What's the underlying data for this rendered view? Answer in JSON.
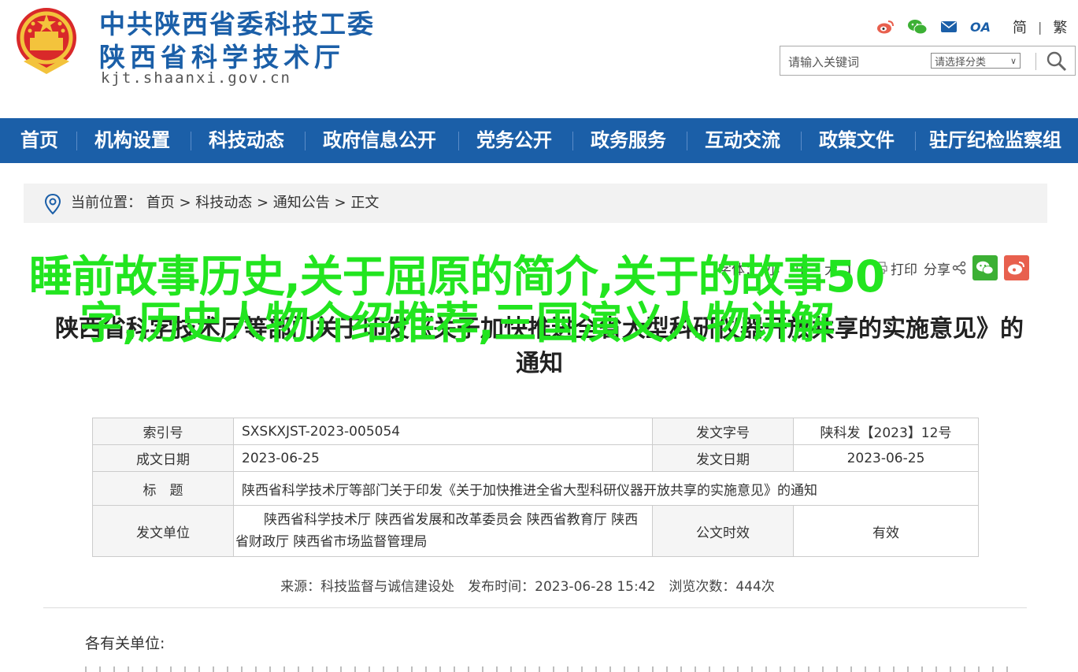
{
  "header": {
    "org_line1": "中共陕西省委科技工委",
    "org_line2": "陕西省科学技术厅",
    "domain": "kjt.shaanxi.gov.cn",
    "icons": [
      "weibo-icon",
      "wechat-icon",
      "mail-icon",
      "oa-icon"
    ],
    "oa_label": "OA",
    "lang_simplified": "简",
    "lang_sep": "|",
    "lang_traditional": "繁",
    "search": {
      "placeholder": "请输入关键词",
      "category_select": "请选择分类",
      "category_caret": "∨"
    }
  },
  "nav": {
    "items": [
      "首页",
      "机构设置",
      "科技动态",
      "政府信息公开",
      "党务公开",
      "政务服务",
      "互动交流",
      "政策文件",
      "驻厅纪检监察组"
    ]
  },
  "breadcrumb": {
    "prefix": "当前位置：",
    "items": [
      "首页",
      "科技动态",
      "通知公告",
      "正文"
    ],
    "sep": " > "
  },
  "article_tools": {
    "font_label_open": "【字体：",
    "font_small": "小",
    "font_medium": "中",
    "font_large": "大",
    "font_label_close": "】",
    "print_label": "打印",
    "share_label": "分享"
  },
  "overlay_text": "睡前故事历史,关于屈原的简介,关于的故事50字,历史人物介绍推荐,三国演义人物讲解",
  "document": {
    "title": "陕西省科学技术厅等部门关于印发《关于加快推进全省大型科研仪器开放共享的实施意见》的通知",
    "meta": {
      "index_label": "索引号",
      "index_value": "SXSKXJST-2023-005054",
      "docno_label": "发文字号",
      "docno_value": "陕科发【2023】12号",
      "written_label": "成文日期",
      "written_value": "2023-06-25",
      "issued_label": "发文日期",
      "issued_value": "2023-06-25",
      "title_label": "标　题",
      "title_value": "陕西省科学技术厅等部门关于印发《关于加快推进全省大型科研仪器开放共享的实施意见》的通知",
      "issuer_label": "发文单位",
      "issuer_value": "陕西省科学技术厅 陕西省发展和改革委员会 陕西省教育厅 陕西省财政厅 陕西省市场监督管理局",
      "validity_label": "公文时效",
      "validity_value": "有效"
    },
    "source_line": "来源：科技监督与诚信建设处　发布时间：2023-06-28 15:42　浏览次数：444次",
    "salutation": "各有关单位:"
  },
  "colors": {
    "brand_blue": "#1b5fa8",
    "overlay_green": "#22e51f",
    "wechat_green": "#3cb034",
    "weibo_red": "#e8604e"
  }
}
